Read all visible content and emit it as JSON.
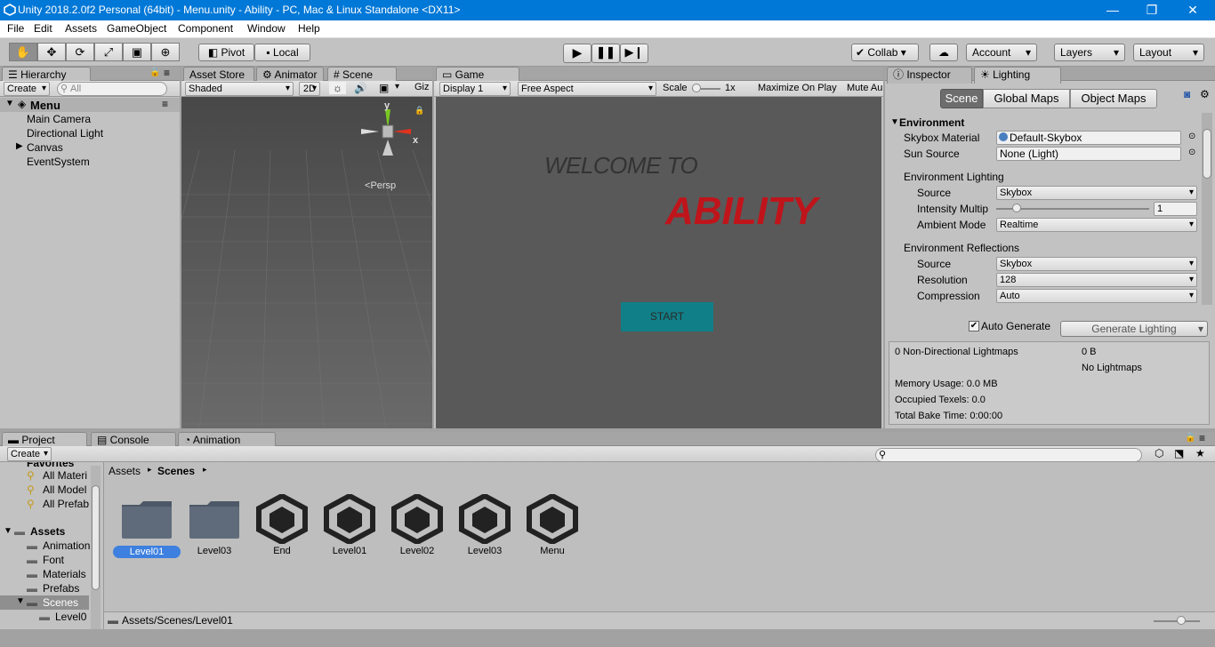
{
  "window": {
    "title": "Unity 2018.2.0f2 Personal (64bit) - Menu.unity - Ability - PC, Mac & Linux Standalone <DX11>",
    "min": "—",
    "max": "❐",
    "close": "✕"
  },
  "menu": [
    "File",
    "Edit",
    "Assets",
    "GameObject",
    "Component",
    "Window",
    "Help"
  ],
  "toolbar": {
    "pivot": "Pivot",
    "local": "Local",
    "collab": "Collab",
    "account": "Account",
    "layers": "Layers",
    "layout": "Layout"
  },
  "hierarchy": {
    "tab": "Hierarchy",
    "create": "Create",
    "search_placeholder": "All",
    "scene": "Menu",
    "items": [
      "Main Camera",
      "Directional Light",
      "Canvas",
      "EventSystem"
    ]
  },
  "scene_panel": {
    "tabs": [
      "Asset Store",
      "Animator",
      "Scene"
    ],
    "shading": "Shaded",
    "mode2d": "2D",
    "gizmos": "Giz",
    "persp": "Persp",
    "axis_y": "y",
    "axis_x": "x"
  },
  "game_panel": {
    "tab": "Game",
    "display": "Display 1",
    "aspect": "Free Aspect",
    "scale_label": "Scale",
    "scale_value": "1x",
    "maximize": "Maximize On Play",
    "mute": "Mute Au",
    "welcome": "WELCOME TO",
    "ability": "ABILITY",
    "start": "START"
  },
  "inspector": {
    "tabs": [
      "Inspector",
      "Lighting"
    ],
    "subtabs": [
      "Scene",
      "Global Maps",
      "Object Maps"
    ],
    "environment": "Environment",
    "skybox_label": "Skybox Material",
    "skybox_value": "Default-Skybox",
    "sun_label": "Sun Source",
    "sun_value": "None (Light)",
    "env_lighting": "Environment Lighting",
    "source_label": "Source",
    "source_value": "Skybox",
    "intensity_label": "Intensity Multip",
    "intensity_value": "1",
    "ambient_label": "Ambient Mode",
    "ambient_value": "Realtime",
    "env_reflections": "Environment Reflections",
    "ref_source_label": "Source",
    "ref_source_value": "Skybox",
    "resolution_label": "Resolution",
    "resolution_value": "128",
    "compression_label": "Compression",
    "compression_value": "Auto",
    "auto_generate": "Auto Generate",
    "generate_lighting": "Generate Lighting",
    "stats": {
      "lightmaps": "0 Non-Directional Lightmaps",
      "size": "0 B",
      "no_lightmaps": "No Lightmaps",
      "memory": "Memory Usage: 0.0 MB",
      "texels": "Occupied Texels: 0.0",
      "bake_time": "Total Bake Time: 0:00:00"
    }
  },
  "project": {
    "tabs": [
      "Project",
      "Console",
      "Animation"
    ],
    "create": "Create",
    "favorites": "Favorites",
    "fav_items": [
      "All Materi",
      "All Model",
      "All Prefab"
    ],
    "assets": "Assets",
    "asset_items": [
      "Animation",
      "Font",
      "Materials",
      "Prefabs",
      "Scenes",
      "Level0"
    ],
    "breadcrumb": [
      "Assets",
      "Scenes"
    ],
    "files": [
      {
        "name": "Level01",
        "type": "folder",
        "selected": true
      },
      {
        "name": "Level03",
        "type": "folder"
      },
      {
        "name": "End",
        "type": "unity"
      },
      {
        "name": "Level01",
        "type": "unity"
      },
      {
        "name": "Level02",
        "type": "unity"
      },
      {
        "name": "Level03",
        "type": "unity"
      },
      {
        "name": "Menu",
        "type": "unity"
      }
    ],
    "path": "Assets/Scenes/Level01"
  },
  "colors": {
    "accent": "#0078d7",
    "ability_red": "#c0141b",
    "start_btn": "#117f88",
    "selected": "#3d80df"
  }
}
